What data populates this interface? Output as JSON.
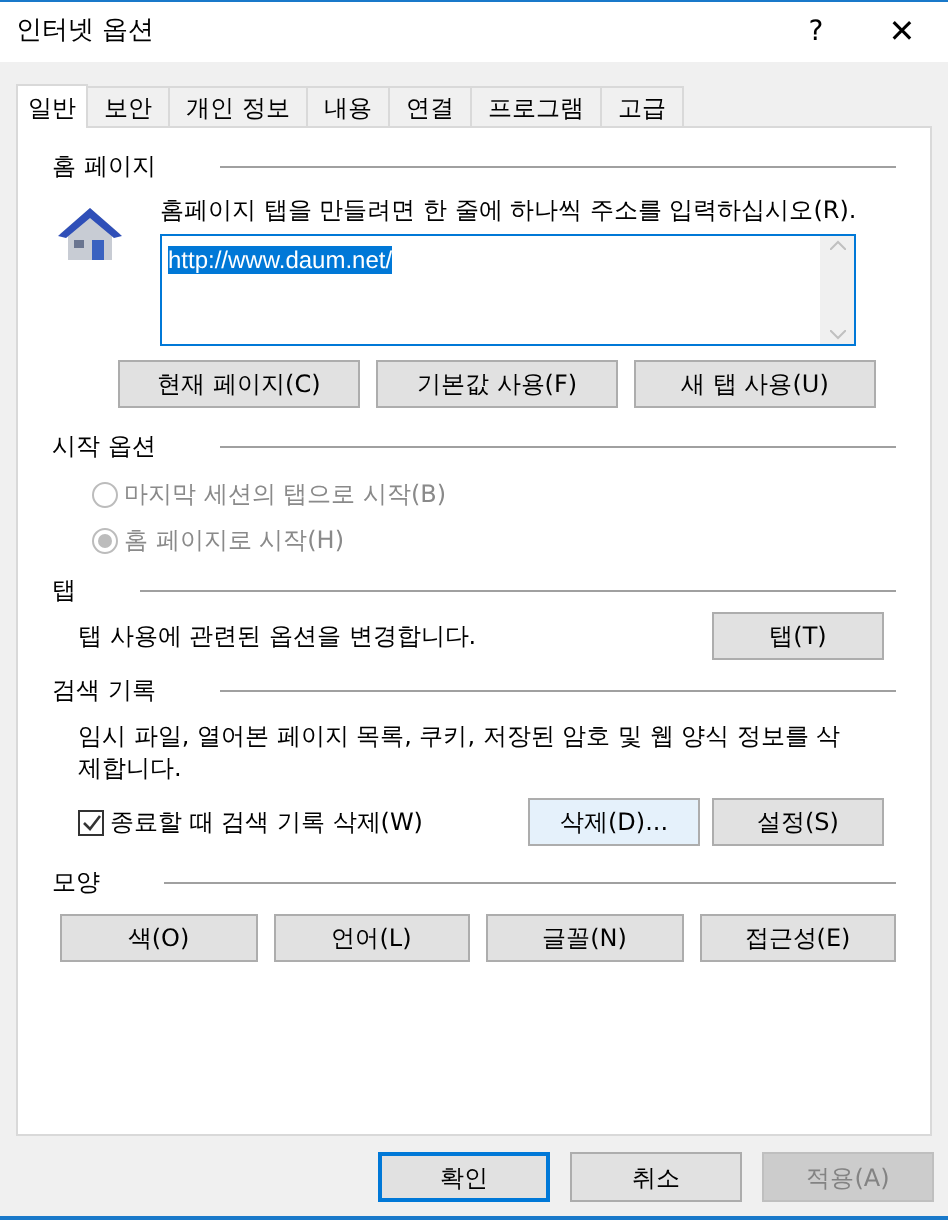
{
  "window": {
    "title": "인터넷 옵션",
    "help": "?",
    "close": "✕"
  },
  "tabs": [
    {
      "label": "일반",
      "selected": true
    },
    {
      "label": "보안",
      "selected": false
    },
    {
      "label": "개인 정보",
      "selected": false
    },
    {
      "label": "내용",
      "selected": false
    },
    {
      "label": "연결",
      "selected": false
    },
    {
      "label": "프로그램",
      "selected": false
    },
    {
      "label": "고급",
      "selected": false
    }
  ],
  "home_page": {
    "heading": "홈 페이지",
    "instruction": "홈페이지 탭을 만들려면 한 줄에 하나씩 주소를 입력하십시오(R).",
    "value": "http://www.daum.net/",
    "buttons": [
      "현재 페이지(C)",
      "기본값 사용(F)",
      "새 탭 사용(U)"
    ]
  },
  "startup": {
    "heading": "시작 옵션",
    "disabled": true,
    "options": [
      {
        "label": "마지막 세션의 탭으로 시작(B)",
        "selected": false
      },
      {
        "label": "홈 페이지로 시작(H)",
        "selected": true
      }
    ]
  },
  "tabs_section": {
    "heading": "탭",
    "text": "탭 사용에 관련된 옵션을 변경합니다.",
    "button": "탭(T)"
  },
  "history": {
    "heading": "검색 기록",
    "text": "임시 파일, 열어본 페이지 목록, 쿠키, 저장된 암호 및 웹 양식 정보를 삭제합니다.",
    "checkbox": {
      "label": "종료할 때 검색 기록 삭제(W)",
      "checked": true
    },
    "buttons": [
      {
        "label": "삭제(D)...",
        "focused": true
      },
      {
        "label": "설정(S)",
        "focused": false
      }
    ]
  },
  "appearance": {
    "heading": "모양",
    "buttons": [
      "색(O)",
      "언어(L)",
      "글꼴(N)",
      "접근성(E)"
    ]
  },
  "footer": [
    {
      "label": "확인",
      "default": true,
      "disabled": false
    },
    {
      "label": "취소",
      "default": false,
      "disabled": false
    },
    {
      "label": "적용(A)",
      "default": false,
      "disabled": true
    }
  ]
}
